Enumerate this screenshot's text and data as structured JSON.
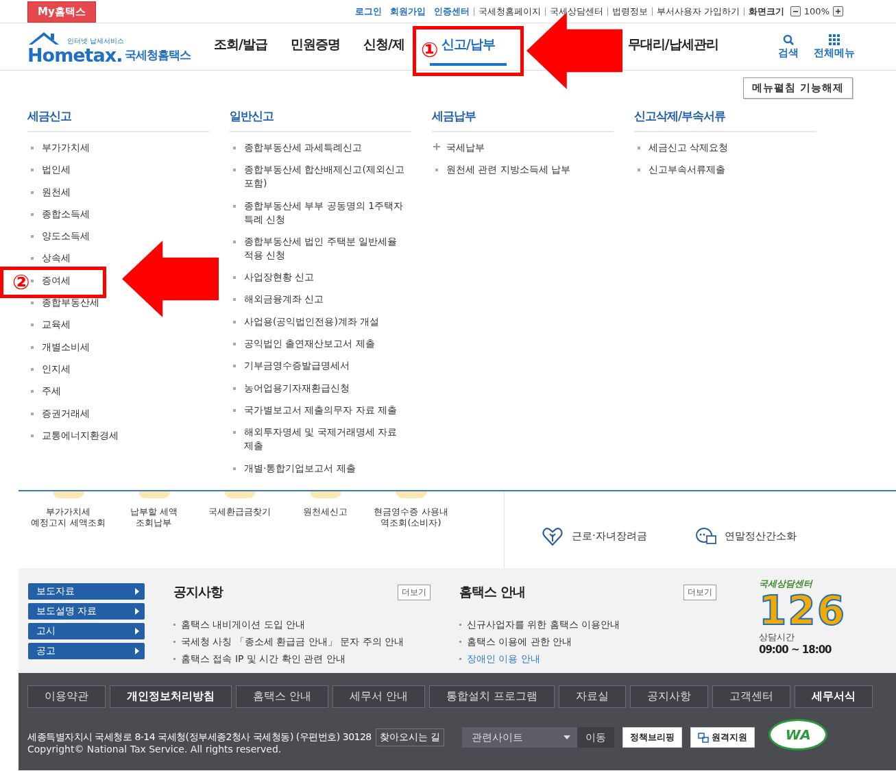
{
  "topbar": {
    "brand_tab": "My홈택스",
    "links": [
      {
        "label": "로그인",
        "kind": "primary"
      },
      {
        "label": "회원가입",
        "kind": "primary"
      },
      {
        "label": "인증센터",
        "kind": "primary"
      },
      {
        "label": "국세청홈페이지",
        "kind": "plain"
      },
      {
        "label": "국세상담센터",
        "kind": "plain"
      },
      {
        "label": "법령정보",
        "kind": "plain"
      },
      {
        "label": "부서사용자 가입하기",
        "kind": "plain"
      }
    ],
    "zoom": {
      "label": "화면크기",
      "value": "100%"
    }
  },
  "header": {
    "logo": {
      "small": "인터넷 납세서비스",
      "word": "Hometax.",
      "name": "국세청홈택스"
    },
    "nav": [
      {
        "label": "조회/발급",
        "selected": false
      },
      {
        "label": "민원증명",
        "selected": false
      },
      {
        "label": "신청/제",
        "selected": false
      },
      {
        "label": "신고/납부",
        "selected": true
      },
      {
        "label": "무대리/납세관리",
        "selected": false
      }
    ],
    "search": "검색",
    "all_menu": "전체메뉴"
  },
  "megamenu": {
    "toggle_button": "메뉴펼침 기능해제",
    "columns": [
      {
        "title": "세금신고",
        "items": [
          "부가가치세",
          "법인세",
          "원천세",
          "종합소득세",
          "양도소득세",
          "상속세",
          "증여세",
          "종합부동산세",
          "교육세",
          "개별소비세",
          "인지세",
          "주세",
          "증권거래세",
          "교통에너지환경세"
        ]
      },
      {
        "title": "일반신고",
        "items": [
          "종합부동산세 과세특례신고",
          "종합부동산세 합산배제신고(제외신고 포함)",
          "종합부동산세 부부 공동명의 1주택자 특례 신청",
          "종합부동산세 법인 주택분 일반세율 적용 신청",
          "사업장현황 신고",
          "해외금융계좌 신고",
          "사업용(공익법인전용)계좌 개설",
          "공익법인 출연재산보고서 제출",
          "기부금영수증발급명세서",
          "농어업용기자재환급신청",
          "국가별보고서 제출의무자 자료 제출",
          "해외투자명세 및 국제거래명세 자료 제출",
          "개별·통합기업보고서 제출"
        ]
      },
      {
        "title": "세금납부",
        "items": [
          {
            "label": "국세납부",
            "kind": "expandable"
          },
          {
            "label": "원천세 관련 지방소득세 납부",
            "kind": "link"
          }
        ]
      },
      {
        "title": "신고삭제/부속서류",
        "items": [
          "세금신고 삭제요청",
          "신고부속서류제출"
        ]
      }
    ]
  },
  "quick": {
    "left": [
      "부가가치세\n예정고지 세액조회",
      "납부할 세액\n조회납부",
      "국세환급금찾기",
      "원천세신고",
      "현금영수증 사용내\n역조회(소비자)"
    ],
    "right": [
      {
        "label": "근로·자녀장려금",
        "kind": "heart"
      },
      {
        "label": "연말정산간소화",
        "kind": "chat"
      }
    ]
  },
  "info": {
    "side_buttons": [
      "보도자료",
      "보도설명 자료",
      "고시",
      "공고"
    ],
    "boards": [
      {
        "title": "공지사항",
        "more": "더보기",
        "items": [
          {
            "label": "홈택스 내비게이션 도입 안내",
            "highlighted": false
          },
          {
            "label": "국세청 사칭 「종소세 환급금 안내」 문자 주의 안내",
            "highlighted": false
          },
          {
            "label": "홈택스 접속 IP 및 시간 확인 관련 안내",
            "highlighted": false
          }
        ]
      },
      {
        "title": "홈택스 안내",
        "more": "더보기",
        "items": [
          {
            "label": "신규사업자를 위한 홈택스 이용안내",
            "highlighted": false
          },
          {
            "label": "홈택스 이용에 관한 안내",
            "highlighted": false
          },
          {
            "label": "장애인 이용 안내",
            "highlighted": true
          }
        ]
      }
    ],
    "center": {
      "title": "국세상담센터",
      "number": "126",
      "hours_label": "상담시간",
      "hours": "09:00 ~ 18:00"
    }
  },
  "footer": {
    "links": [
      {
        "label": "이용약관",
        "emphasized": false
      },
      {
        "label": "개인정보처리방침",
        "emphasized": true
      },
      {
        "label": "홈택스 안내",
        "emphasized": false
      },
      {
        "label": "세무서 안내",
        "emphasized": false
      },
      {
        "label": "통합설치 프로그램",
        "emphasized": false
      },
      {
        "label": "자료실",
        "emphasized": false
      },
      {
        "label": "공지사항",
        "emphasized": false
      },
      {
        "label": "고객센터",
        "emphasized": false
      },
      {
        "label": "세무서식",
        "emphasized": true
      }
    ],
    "address": "세종특별자치시 국세청로 8-14 국세청(정부세종2청사 국세청동) (우편번호) 30128",
    "directions": "찾아오시는 길",
    "site_select": "관련사이트",
    "go": "이동",
    "briefing": "정책브리핑",
    "remote": "원격지원",
    "badge": "WA",
    "copyright": "Copyright© National Tax Service. All rights reserved."
  },
  "annotations": [
    {
      "label": "①"
    },
    {
      "label": "②"
    }
  ]
}
